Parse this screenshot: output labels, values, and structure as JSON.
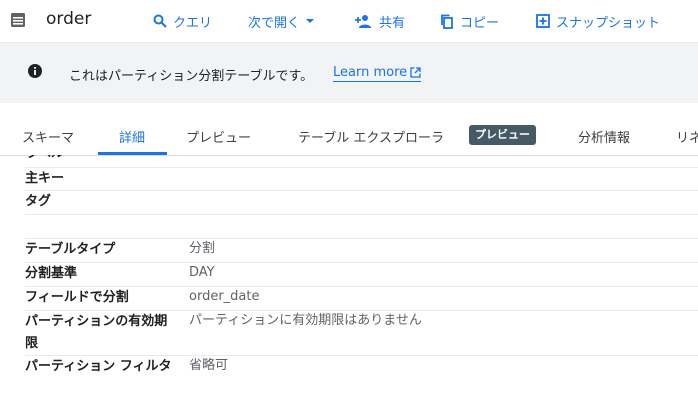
{
  "header": {
    "title": "order",
    "actions": {
      "query": "クエリ",
      "open_in": "次で開く",
      "share": "共有",
      "copy": "コピー",
      "snapshot": "スナップショット"
    }
  },
  "banner": {
    "message": "これはパーティション分割テーブルです。",
    "learn_more": "Learn more"
  },
  "tabs": {
    "schema": "スキーマ",
    "details": "詳細",
    "preview": "プレビュー",
    "table_explorer": "テーブル エクスプローラ",
    "preview_badge": "プレビュー",
    "insights": "分析情報",
    "lineage_partial": "リネ"
  },
  "details": {
    "cut_label": "ラベル",
    "primary_key_label": "主キー",
    "tags_label": "タグ",
    "table_type_label": "テーブルタイプ",
    "table_type_value": "分割",
    "partition_by_label": "分割基準",
    "partition_by_value": "DAY",
    "partition_field_label": "フィールドで分割",
    "partition_field_value": "order_date",
    "partition_expiry_label": "パーティションの有効期限",
    "partition_expiry_value": "パーティションに有効期限はありません",
    "partition_filter_label": "パーティション フィルタ",
    "partition_filter_value": "省略可"
  },
  "colors": {
    "accent": "#1a73e8",
    "banner_bg": "#f1f3f4",
    "badge_bg": "#455a64"
  }
}
